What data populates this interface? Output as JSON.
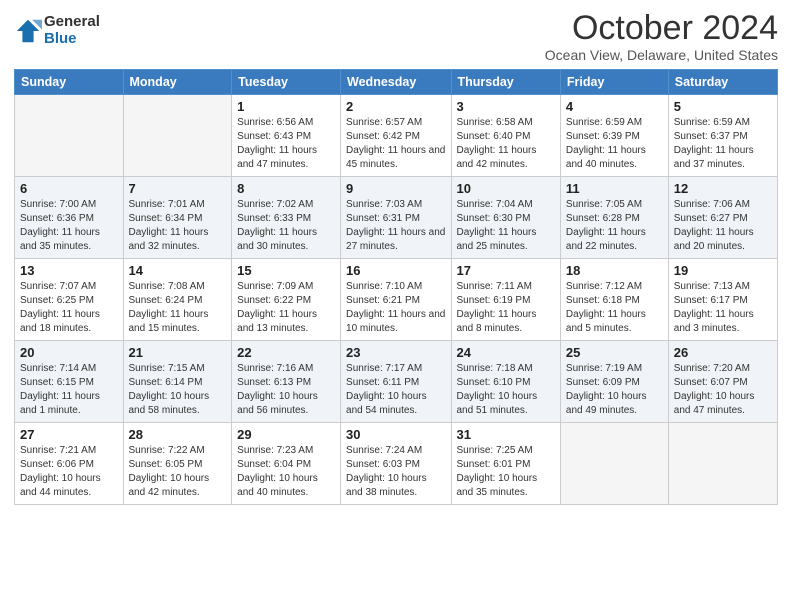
{
  "logo": {
    "general": "General",
    "blue": "Blue"
  },
  "title": "October 2024",
  "location": "Ocean View, Delaware, United States",
  "days_of_week": [
    "Sunday",
    "Monday",
    "Tuesday",
    "Wednesday",
    "Thursday",
    "Friday",
    "Saturday"
  ],
  "weeks": [
    [
      {
        "day": "",
        "info": ""
      },
      {
        "day": "",
        "info": ""
      },
      {
        "day": "1",
        "info": "Sunrise: 6:56 AM\nSunset: 6:43 PM\nDaylight: 11 hours and 47 minutes."
      },
      {
        "day": "2",
        "info": "Sunrise: 6:57 AM\nSunset: 6:42 PM\nDaylight: 11 hours and 45 minutes."
      },
      {
        "day": "3",
        "info": "Sunrise: 6:58 AM\nSunset: 6:40 PM\nDaylight: 11 hours and 42 minutes."
      },
      {
        "day": "4",
        "info": "Sunrise: 6:59 AM\nSunset: 6:39 PM\nDaylight: 11 hours and 40 minutes."
      },
      {
        "day": "5",
        "info": "Sunrise: 6:59 AM\nSunset: 6:37 PM\nDaylight: 11 hours and 37 minutes."
      }
    ],
    [
      {
        "day": "6",
        "info": "Sunrise: 7:00 AM\nSunset: 6:36 PM\nDaylight: 11 hours and 35 minutes."
      },
      {
        "day": "7",
        "info": "Sunrise: 7:01 AM\nSunset: 6:34 PM\nDaylight: 11 hours and 32 minutes."
      },
      {
        "day": "8",
        "info": "Sunrise: 7:02 AM\nSunset: 6:33 PM\nDaylight: 11 hours and 30 minutes."
      },
      {
        "day": "9",
        "info": "Sunrise: 7:03 AM\nSunset: 6:31 PM\nDaylight: 11 hours and 27 minutes."
      },
      {
        "day": "10",
        "info": "Sunrise: 7:04 AM\nSunset: 6:30 PM\nDaylight: 11 hours and 25 minutes."
      },
      {
        "day": "11",
        "info": "Sunrise: 7:05 AM\nSunset: 6:28 PM\nDaylight: 11 hours and 22 minutes."
      },
      {
        "day": "12",
        "info": "Sunrise: 7:06 AM\nSunset: 6:27 PM\nDaylight: 11 hours and 20 minutes."
      }
    ],
    [
      {
        "day": "13",
        "info": "Sunrise: 7:07 AM\nSunset: 6:25 PM\nDaylight: 11 hours and 18 minutes."
      },
      {
        "day": "14",
        "info": "Sunrise: 7:08 AM\nSunset: 6:24 PM\nDaylight: 11 hours and 15 minutes."
      },
      {
        "day": "15",
        "info": "Sunrise: 7:09 AM\nSunset: 6:22 PM\nDaylight: 11 hours and 13 minutes."
      },
      {
        "day": "16",
        "info": "Sunrise: 7:10 AM\nSunset: 6:21 PM\nDaylight: 11 hours and 10 minutes."
      },
      {
        "day": "17",
        "info": "Sunrise: 7:11 AM\nSunset: 6:19 PM\nDaylight: 11 hours and 8 minutes."
      },
      {
        "day": "18",
        "info": "Sunrise: 7:12 AM\nSunset: 6:18 PM\nDaylight: 11 hours and 5 minutes."
      },
      {
        "day": "19",
        "info": "Sunrise: 7:13 AM\nSunset: 6:17 PM\nDaylight: 11 hours and 3 minutes."
      }
    ],
    [
      {
        "day": "20",
        "info": "Sunrise: 7:14 AM\nSunset: 6:15 PM\nDaylight: 11 hours and 1 minute."
      },
      {
        "day": "21",
        "info": "Sunrise: 7:15 AM\nSunset: 6:14 PM\nDaylight: 10 hours and 58 minutes."
      },
      {
        "day": "22",
        "info": "Sunrise: 7:16 AM\nSunset: 6:13 PM\nDaylight: 10 hours and 56 minutes."
      },
      {
        "day": "23",
        "info": "Sunrise: 7:17 AM\nSunset: 6:11 PM\nDaylight: 10 hours and 54 minutes."
      },
      {
        "day": "24",
        "info": "Sunrise: 7:18 AM\nSunset: 6:10 PM\nDaylight: 10 hours and 51 minutes."
      },
      {
        "day": "25",
        "info": "Sunrise: 7:19 AM\nSunset: 6:09 PM\nDaylight: 10 hours and 49 minutes."
      },
      {
        "day": "26",
        "info": "Sunrise: 7:20 AM\nSunset: 6:07 PM\nDaylight: 10 hours and 47 minutes."
      }
    ],
    [
      {
        "day": "27",
        "info": "Sunrise: 7:21 AM\nSunset: 6:06 PM\nDaylight: 10 hours and 44 minutes."
      },
      {
        "day": "28",
        "info": "Sunrise: 7:22 AM\nSunset: 6:05 PM\nDaylight: 10 hours and 42 minutes."
      },
      {
        "day": "29",
        "info": "Sunrise: 7:23 AM\nSunset: 6:04 PM\nDaylight: 10 hours and 40 minutes."
      },
      {
        "day": "30",
        "info": "Sunrise: 7:24 AM\nSunset: 6:03 PM\nDaylight: 10 hours and 38 minutes."
      },
      {
        "day": "31",
        "info": "Sunrise: 7:25 AM\nSunset: 6:01 PM\nDaylight: 10 hours and 35 minutes."
      },
      {
        "day": "",
        "info": ""
      },
      {
        "day": "",
        "info": ""
      }
    ]
  ]
}
